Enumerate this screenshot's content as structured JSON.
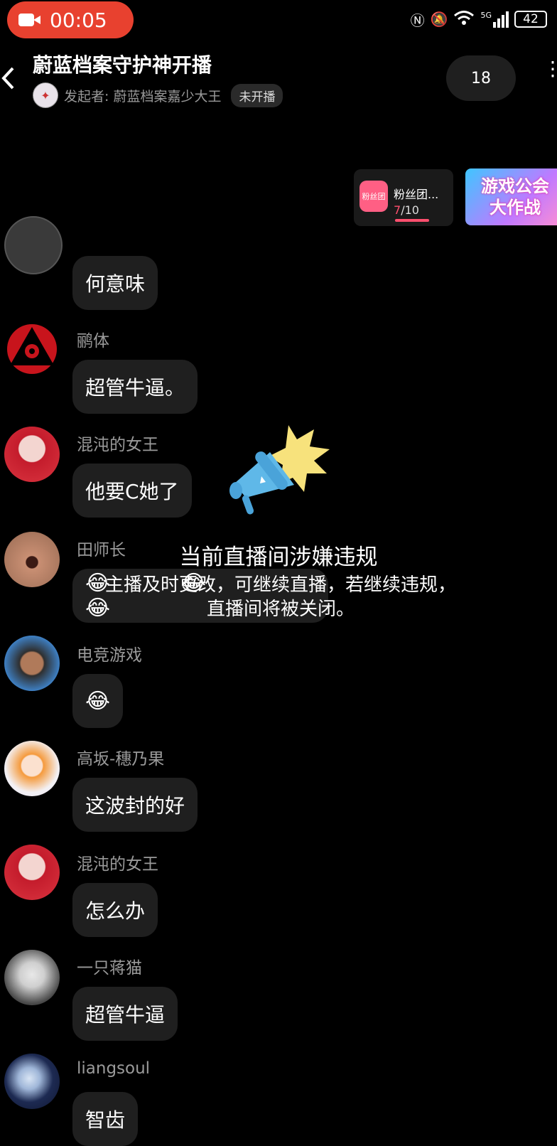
{
  "status_bar": {
    "rec_time": "00:05",
    "network": "5G",
    "battery": "42"
  },
  "header": {
    "back_icon": "chevron-left-icon",
    "title": "蔚蓝档案守护神开播",
    "host_label": "发起者: 蔚蓝档案嘉少大王",
    "host_status": "未开播",
    "member_count": "18"
  },
  "fan_card": {
    "title": "粉丝团...",
    "icon_label": "粉丝团",
    "progress_current": "7",
    "progress_total": "/10"
  },
  "banner": {
    "line1": "游戏公会",
    "line2": "大作战"
  },
  "messages": [
    {
      "user": "",
      "text": "何意味"
    },
    {
      "user": "鹂体",
      "text": "超管牛逼。"
    },
    {
      "user": "混沌的女王",
      "text": "他要C她了"
    },
    {
      "user": "田师长",
      "text": "😂😂😂"
    },
    {
      "user": "电竞游戏",
      "text": "😂"
    },
    {
      "user": "高坂-穗乃果",
      "text": "这波封的好"
    },
    {
      "user": "混沌的女王",
      "text": "怎么办"
    },
    {
      "user": "一只蒋猫",
      "text": "超管牛逼"
    },
    {
      "user": "liangsoul",
      "text": "智齿"
    }
  ],
  "notice": {
    "title": "当前直播间涉嫌违规",
    "body": "主播及时更改，可继续直播，若继续违规，直播间将被关闭。"
  },
  "colors": {
    "record_pill": "#e8412f",
    "bubble": "#1f1f1f",
    "accent_pink": "#ff4f6e",
    "megaphone": "#5fb8e8",
    "burst": "#f7e27c"
  }
}
